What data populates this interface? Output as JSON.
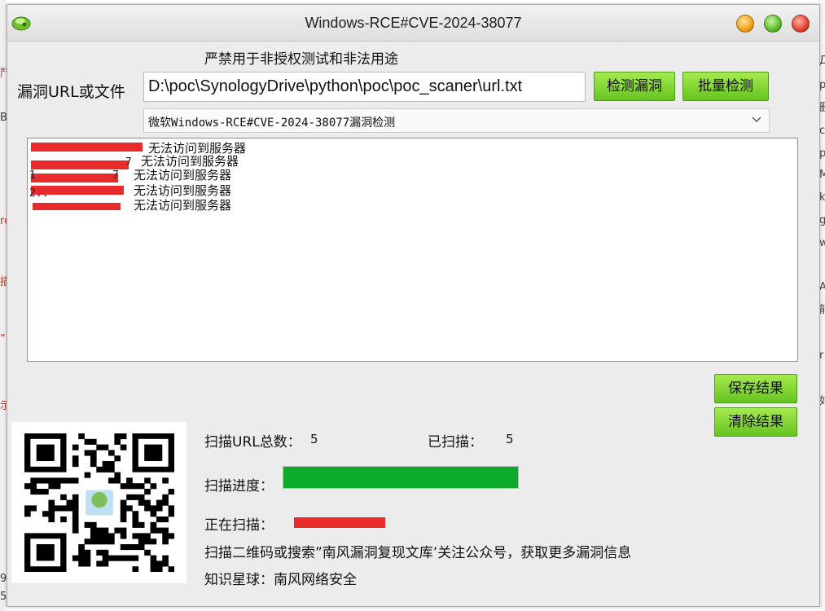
{
  "window": {
    "title": "Windows-RCE#CVE-2024-38077"
  },
  "warning_text": "严禁用于非授权测试和非法用途",
  "url_label": "漏洞URL或文件",
  "url_value": "D:\\poc\\SynologyDrive\\python\\poc\\poc_scaner\\url.txt",
  "buttons": {
    "detect": "检测漏洞",
    "batch": "批量检测",
    "save": "保存结果",
    "clear": "清除结果"
  },
  "poc_select": {
    "selected": "微软Windows-RCE#CVE-2024-38077漏洞检测"
  },
  "log_lines": [
    {
      "text": "无法访问到服务器"
    },
    {
      "text": "无法访问到服务器"
    },
    {
      "text": "无法访问到服务器"
    },
    {
      "text": "无法访问到服务器"
    },
    {
      "text": "无法访问到服务器"
    }
  ],
  "log_ghost_fragments": [
    "7",
    "7",
    "1",
    "2.."
  ],
  "stats": {
    "total_label": "扫描URL总数：",
    "total_value": "5",
    "scanned_label": "已扫描：",
    "scanned_value": "5",
    "progress_label": "扫描进度：",
    "progress_percent": 100,
    "current_label": "正在扫描："
  },
  "promo_text": "扫描二维码或搜索”南风漏洞复现文库’关注公众号，获取更多漏洞信息",
  "planet_text": "知识星球：南风网络安全",
  "colors": {
    "button_green": "#7fd23a",
    "progress_green": "#0cab2b",
    "redaction_red": "#ea2b2b"
  },
  "icons": {
    "app": "app-icon",
    "minimize": "minimize-icon",
    "maximize": "maximize-icon",
    "close": "close-icon",
    "dropdown": "chevron-down-icon",
    "qr": "qr-code"
  },
  "background_fragments": {
    "left": [
      "鬥",
      "B",
      "re",
      "描",
      "”",
      "示",
      "9",
      "5"
    ],
    "right": [
      "Д",
      "p",
      "删",
      "c",
      "p.",
      "M",
      "k",
      "g",
      "w",
      "A",
      "能",
      "r",
      "如"
    ]
  }
}
